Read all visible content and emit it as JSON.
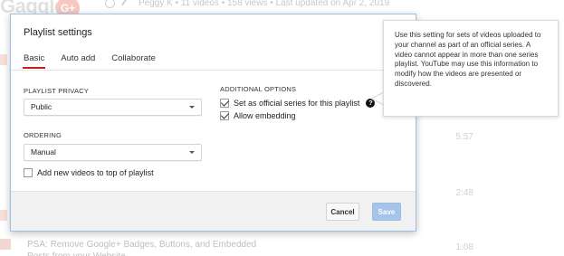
{
  "background": {
    "logo_text": "Gaggle",
    "gplus_text": "G+",
    "meta": "Peggy K • 11 videos • 158 views • Last updated on Apr 2, 2019",
    "durations": [
      "5:57",
      "2:48",
      "1:08"
    ],
    "video_title": "PSA: Remove Google+ Badges, Buttons, and Embedded Posts from your Website"
  },
  "dialog": {
    "title": "Playlist settings",
    "tabs": [
      {
        "label": "Basic",
        "active": true
      },
      {
        "label": "Auto add",
        "active": false
      },
      {
        "label": "Collaborate",
        "active": false
      }
    ],
    "privacy": {
      "label": "PLAYLIST PRIVACY",
      "value": "Public"
    },
    "ordering": {
      "label": "ORDERING",
      "value": "Manual"
    },
    "add_to_top": {
      "label": "Add new videos to top of playlist",
      "checked": false
    },
    "additional": {
      "label": "ADDITIONAL OPTIONS",
      "official_series": {
        "label": "Set as official series for this playlist",
        "checked": true
      },
      "allow_embedding": {
        "label": "Allow embedding",
        "checked": true
      }
    },
    "buttons": {
      "cancel": "Cancel",
      "save": "Save"
    }
  },
  "tooltip": {
    "text": "Use this setting for sets of videos uploaded to your channel as part of an official series. A video cannot appear in more than one series playlist. YouTube may use this information to modify how the videos are presented or discovered."
  },
  "colors": {
    "tab_underline": "#cc181e",
    "save_button": "#a4c4e9",
    "dialog_border": "#9cc0e8"
  },
  "icons": [
    "clock-icon",
    "edit-icon",
    "help-icon",
    "caret-down-icon",
    "checkmark-icon"
  ]
}
